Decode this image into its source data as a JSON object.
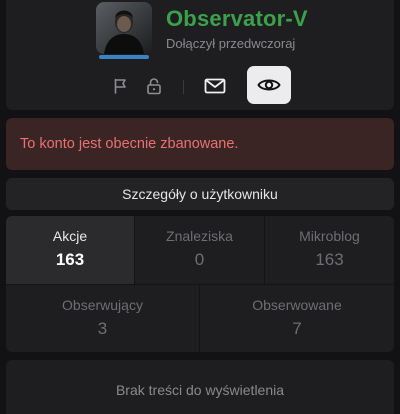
{
  "profile": {
    "username": "Observator-V",
    "joined": "Dołączył przedwczoraj",
    "accent_color": "#3ca14b"
  },
  "actions": {
    "icons": [
      "flag-icon",
      "lock-icon",
      "mail-icon",
      "eye-icon"
    ]
  },
  "ban_alert": {
    "text": "To konto jest obecnie zbanowane.",
    "color": "#e77272"
  },
  "details": {
    "label": "Szczegóły o użytkowniku"
  },
  "stats": [
    {
      "label": "Akcje",
      "value": "163"
    },
    {
      "label": "Znaleziska",
      "value": "0"
    },
    {
      "label": "Mikroblog",
      "value": "163"
    },
    {
      "label": "Obserwujący",
      "value": "3"
    },
    {
      "label": "Obserwowane",
      "value": "7"
    }
  ],
  "empty": {
    "text": "Brak treści do wyświetlenia"
  }
}
